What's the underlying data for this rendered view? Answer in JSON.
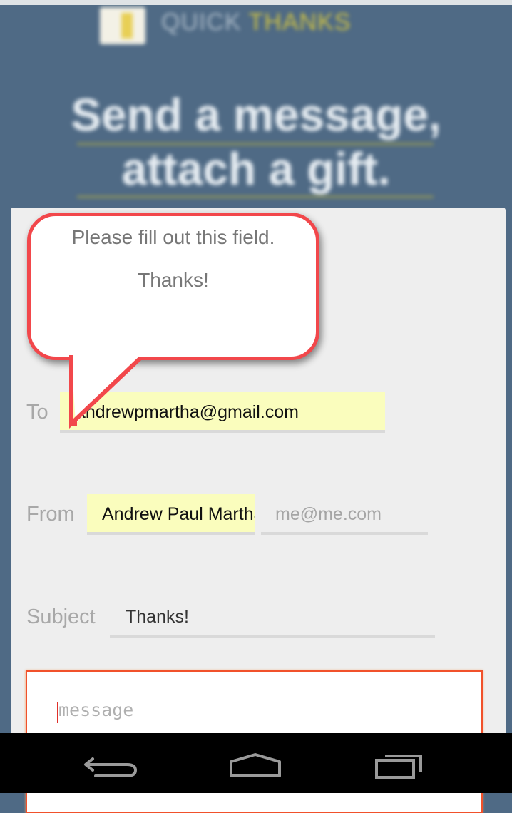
{
  "header": {
    "brand_part1": "QUICK",
    "brand_part2": "THANKS",
    "headline_line1": "Send a message,",
    "headline_line2": "attach a gift."
  },
  "tooltip": {
    "line1": "Please fill out this field.",
    "line2": "Thanks!"
  },
  "form": {
    "to_label": "To",
    "to_value": "andrewpmartha@gmail.com",
    "from_label": "From",
    "from_name_value": "Andrew Paul Martha",
    "from_email_placeholder": "me@me.com",
    "subject_label": "Subject",
    "subject_value": "Thanks!",
    "message_placeholder": "message"
  },
  "colors": {
    "accent_red": "#f2474b",
    "field_highlight": "#fafdbd",
    "header_bg": "#4f6a85"
  },
  "nav": {
    "back_icon": "back-icon",
    "home_icon": "home-icon",
    "recents_icon": "recents-icon"
  }
}
